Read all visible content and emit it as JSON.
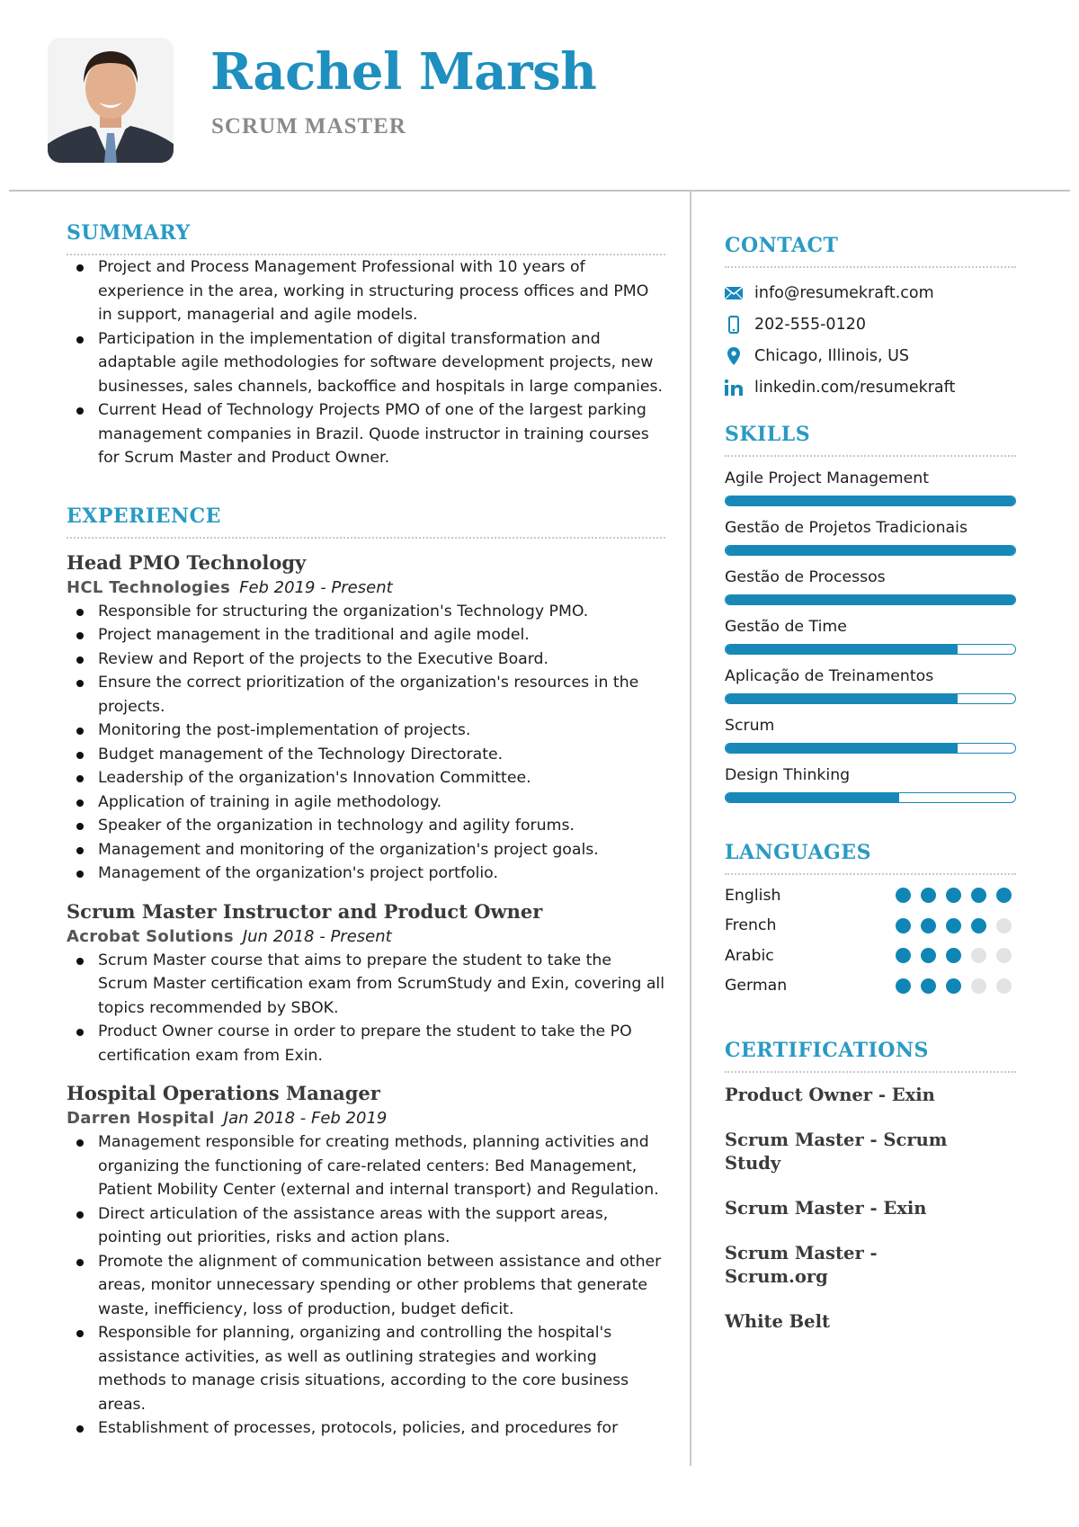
{
  "header": {
    "name": "Rachel Marsh",
    "title": "SCRUM MASTER",
    "photo_alt": "profile-photo"
  },
  "colors": {
    "accent": "#1e8fbf",
    "bar": "#1788b8",
    "dot_on": "#0f86b6",
    "dot_off": "#e3e3e3",
    "subtitle": "#8a8a8a"
  },
  "summary": {
    "heading": "SUMMARY",
    "items": [
      "Project and Process Management Professional with 10 years of experience in the area, working in structuring process offices and PMO in support, managerial and agile models.",
      "Participation in the implementation of digital transformation and adaptable agile methodologies for software development projects, new businesses, sales channels, backoffice and hospitals in large companies.",
      "Current Head of Technology Projects PMO of one of the largest parking management companies in Brazil. Quode instructor in training courses for Scrum Master and Product Owner."
    ]
  },
  "experience": {
    "heading": "EXPERIENCE",
    "jobs": [
      {
        "title": "Head PMO Technology",
        "company": "HCL Technologies",
        "dates": "Feb 2019 - Present",
        "items": [
          "Responsible for structuring the organization's Technology PMO.",
          "Project management in the traditional and agile model.",
          "Review and Report of the projects to the Executive Board.",
          "Ensure the correct prioritization of the organization's resources in the projects.",
          "Monitoring the post-implementation of projects.",
          "Budget management of the Technology Directorate.",
          "Leadership of the organization's Innovation Committee.",
          "Application of training in agile methodology.",
          "Speaker of the organization in technology and agility forums.",
          "Management and monitoring of the organization's project goals.",
          "Management of the organization's project portfolio."
        ]
      },
      {
        "title": "Scrum Master Instructor and Product Owner",
        "company": "Acrobat Solutions",
        "dates": "Jun 2018 - Present",
        "items": [
          "Scrum Master course that aims to prepare the student to take the Scrum Master certification exam from ScrumStudy and Exin, covering all topics recommended by SBOK.",
          "Product Owner course in order to prepare the student to take the PO certification exam from Exin."
        ]
      },
      {
        "title": "Hospital Operations Manager",
        "company": "Darren Hospital",
        "dates": "Jan 2018 - Feb 2019",
        "items": [
          "Management responsible for creating methods, planning activities and organizing the functioning of care-related centers: Bed Management, Patient Mobility Center (external and internal transport) and Regulation.",
          "Direct articulation of the assistance areas with the support areas, pointing out priorities, risks and action plans.",
          "Promote the alignment of communication between assistance and other areas, monitor unnecessary spending or other problems that generate waste, inefficiency, loss of production, budget deficit.",
          "Responsible for planning, organizing and controlling the hospital's assistance activities, as well as outlining strategies and working methods to manage crisis situations, according to the core business areas.",
          "Establishment of processes, protocols, policies, and procedures for"
        ]
      }
    ]
  },
  "contact": {
    "heading": "CONTACT",
    "items": [
      {
        "icon": "envelope-icon",
        "value": "info@resumekraft.com"
      },
      {
        "icon": "phone-icon",
        "value": "202-555-0120"
      },
      {
        "icon": "location-pin-icon",
        "value": "Chicago, Illinois, US"
      },
      {
        "icon": "linkedin-icon",
        "value": "linkedin.com/resumekraft"
      }
    ]
  },
  "skills": {
    "heading": "SKILLS",
    "items": [
      {
        "label": "Agile Project Management",
        "level": 100
      },
      {
        "label": "Gestão de Projetos Tradicionais",
        "level": 100
      },
      {
        "label": "Gestão de Processos",
        "level": 100
      },
      {
        "label": "Gestão de Time",
        "level": 80
      },
      {
        "label": "Aplicação de Treinamentos",
        "level": 80
      },
      {
        "label": "Scrum",
        "level": 80
      },
      {
        "label": "Design Thinking",
        "level": 60
      }
    ]
  },
  "languages": {
    "heading": "LANGUAGES",
    "max": 5,
    "items": [
      {
        "label": "English",
        "level": 5
      },
      {
        "label": "French",
        "level": 4
      },
      {
        "label": "Arabic",
        "level": 3
      },
      {
        "label": "German",
        "level": 3
      }
    ]
  },
  "certifications": {
    "heading": "CERTIFICATIONS",
    "items": [
      "Product Owner - Exin",
      "Scrum Master - Scrum Study",
      "Scrum Master - Exin",
      "Scrum Master - Scrum.org",
      "White Belt"
    ]
  }
}
